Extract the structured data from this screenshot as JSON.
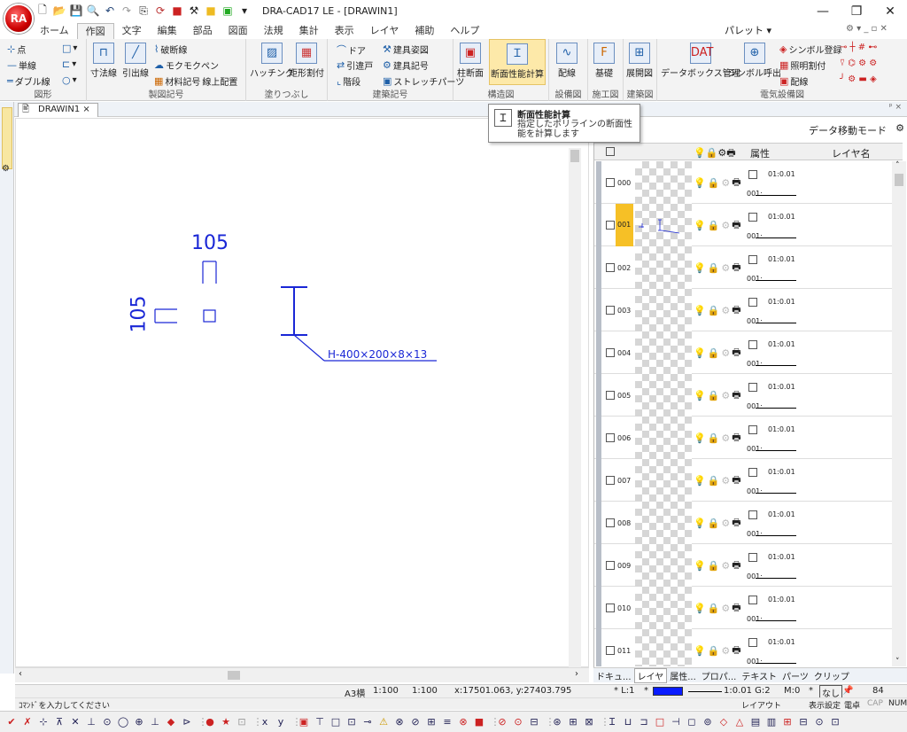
{
  "app": {
    "title": "DRA-CAD17 LE - [DRAWIN1]",
    "logo": "RA"
  },
  "menu": {
    "tabs": [
      "ホーム",
      "作図",
      "文字",
      "編集",
      "部品",
      "図面",
      "法規",
      "集計",
      "表示",
      "レイヤ",
      "補助",
      "ヘルプ"
    ],
    "palette": "パレット",
    "palette_arrow": "▾"
  },
  "ribbon": {
    "groups": [
      {
        "label": "図形",
        "items": [
          "点",
          "単線",
          "ダブル線"
        ]
      },
      {
        "label": "製図記号",
        "items": [
          "寸法線",
          "引出線",
          "破断線",
          "モクモクペン",
          "材料記号",
          "線上配置"
        ]
      },
      {
        "label": "塗りつぶし",
        "items": [
          "ハッチング",
          "矩形割付"
        ]
      },
      {
        "label": "建築記号",
        "items": [
          "ドア",
          "引違戸",
          "階段",
          "建具姿図",
          "建具記号",
          "ストレッチパーツ"
        ]
      },
      {
        "label": "構造図",
        "items": [
          "柱断面",
          "断面性能計算"
        ]
      },
      {
        "label": "設備図",
        "items": [
          "配線"
        ]
      },
      {
        "label": "施工図",
        "items": [
          "基礎"
        ]
      },
      {
        "label": "建築図",
        "items": [
          "展開図"
        ]
      },
      {
        "label": "電気設備図",
        "items": [
          "データボックス管理",
          "シンボル呼出",
          "シンボル登録",
          "照明割付",
          "配線"
        ]
      }
    ]
  },
  "doc": {
    "tab": "DRAWIN1"
  },
  "drawing": {
    "dim_top": "105",
    "dim_left": "105",
    "beam_label": "H-400×200×8×13",
    "color": "#1a27d6"
  },
  "tooltip": {
    "title": "断面性能計算",
    "desc": "指定したポリラインの断面性能を計算します"
  },
  "layer_panel": {
    "mode": "データ移動モード",
    "col_attr": "属性",
    "col_name": "レイヤ名",
    "rows": [
      {
        "num": "000",
        "a1": "01:0.01",
        "a2": "001:"
      },
      {
        "num": "001",
        "a1": "01:0.01",
        "a2": "001:"
      },
      {
        "num": "002",
        "a1": "01:0.01",
        "a2": "001:"
      },
      {
        "num": "003",
        "a1": "01:0.01",
        "a2": "001:"
      },
      {
        "num": "004",
        "a1": "01:0.01",
        "a2": "001:"
      },
      {
        "num": "005",
        "a1": "01:0.01",
        "a2": "001:"
      },
      {
        "num": "006",
        "a1": "01:0.01",
        "a2": "001:"
      },
      {
        "num": "007",
        "a1": "01:0.01",
        "a2": "001:"
      },
      {
        "num": "008",
        "a1": "01:0.01",
        "a2": "001:"
      },
      {
        "num": "009",
        "a1": "01:0.01",
        "a2": "001:"
      },
      {
        "num": "010",
        "a1": "01:0.01",
        "a2": "001:"
      },
      {
        "num": "011",
        "a1": "01:0.01",
        "a2": "001:"
      }
    ],
    "tabs": [
      "ドキュ...",
      "レイヤ",
      "属性...",
      "プロパ...",
      "テキスト",
      "パーツ",
      "クリップ"
    ]
  },
  "status": {
    "paper": "A3横",
    "scale1": "1:100",
    "scale2": "1:100",
    "coords": "x:17501.063, y:27403.795",
    "layer": "* L:1",
    "star": "*",
    "linecode": "1:0.01 G:2",
    "mode": "M:0",
    "star2": "*",
    "none": "なし",
    "num": "84",
    "prompt": "ｺﾏﾝﾄﾞを入力してください",
    "layout": "レイアウト",
    "display": "表示設定",
    "elec": "電卓",
    "caps": "CAP",
    "numlock": "NUM"
  }
}
